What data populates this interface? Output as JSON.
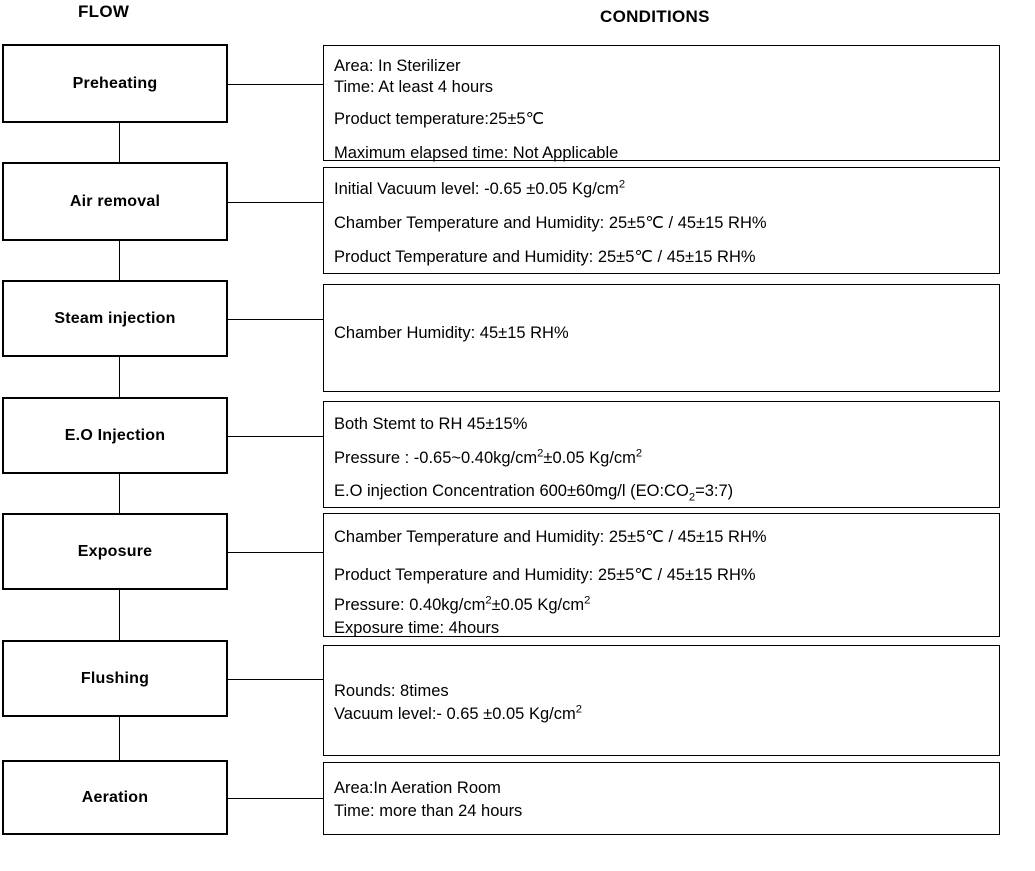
{
  "headers": {
    "flow": "FLOW",
    "conditions": "CONDITIONS"
  },
  "colors": {
    "line": "#000000",
    "background": "#ffffff",
    "text": "#000000"
  },
  "steps": [
    {
      "name": "Preheating",
      "conditions": [
        "Area: In Sterilizer",
        "Time: At least 4 hours",
        "Product temperature:25±5℃",
        "Maximum elapsed time: Not Applicable"
      ]
    },
    {
      "name": "Air removal",
      "conditions": [
        "Initial Vacuum level: -0.65 ±0.05 Kg/cm²",
        "Chamber Temperature and Humidity: 25±5℃ / 45±15 RH%",
        "Product Temperature and Humidity: 25±5℃ / 45±15 RH%"
      ]
    },
    {
      "name": "Steam injection",
      "conditions": [
        "Chamber Humidity: 45±15 RH%"
      ]
    },
    {
      "name": "E.O Injection",
      "conditions": [
        "Both Stemt to RH 45±15%",
        "Pressure : -0.65~0.40kg/cm²±0.05 Kg/cm²",
        "E.O injection Concentration 600±60mg/l (EO:CO₂=3:7)"
      ]
    },
    {
      "name": "Exposure",
      "conditions": [
        "Chamber Temperature and Humidity: 25±5℃ / 45±15 RH%",
        "Product Temperature and Humidity: 25±5℃ / 45±15 RH%",
        "Pressure: 0.40kg/cm²±0.05 Kg/cm²",
        "Exposure time: 4hours"
      ]
    },
    {
      "name": "Flushing",
      "conditions": [
        "Rounds: 8times",
        "Vacuum level:- 0.65 ±0.05 Kg/cm²"
      ]
    },
    {
      "name": "Aeration",
      "conditions": [
        "Area:In Aeration Room",
        "Time: more than 24 hours"
      ]
    }
  ]
}
